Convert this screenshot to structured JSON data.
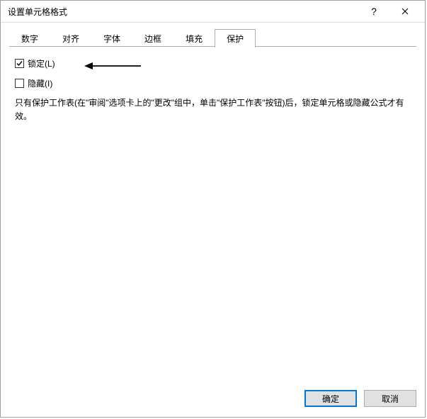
{
  "titlebar": {
    "title": "设置单元格格式",
    "help_icon": "?",
    "close_icon": "✕"
  },
  "tabs": [
    {
      "label": "数字",
      "active": false
    },
    {
      "label": "对齐",
      "active": false
    },
    {
      "label": "字体",
      "active": false
    },
    {
      "label": "边框",
      "active": false
    },
    {
      "label": "填充",
      "active": false
    },
    {
      "label": "保护",
      "active": true
    }
  ],
  "protection": {
    "locked": {
      "label": "锁定(L)",
      "checked": true
    },
    "hidden": {
      "label": "隐藏(I)",
      "checked": false
    },
    "description": "只有保护工作表(在\"审阅\"选项卡上的\"更改\"组中，单击\"保护工作表\"按钮)后，锁定单元格或隐藏公式才有效。"
  },
  "buttons": {
    "ok": "确定",
    "cancel": "取消"
  }
}
